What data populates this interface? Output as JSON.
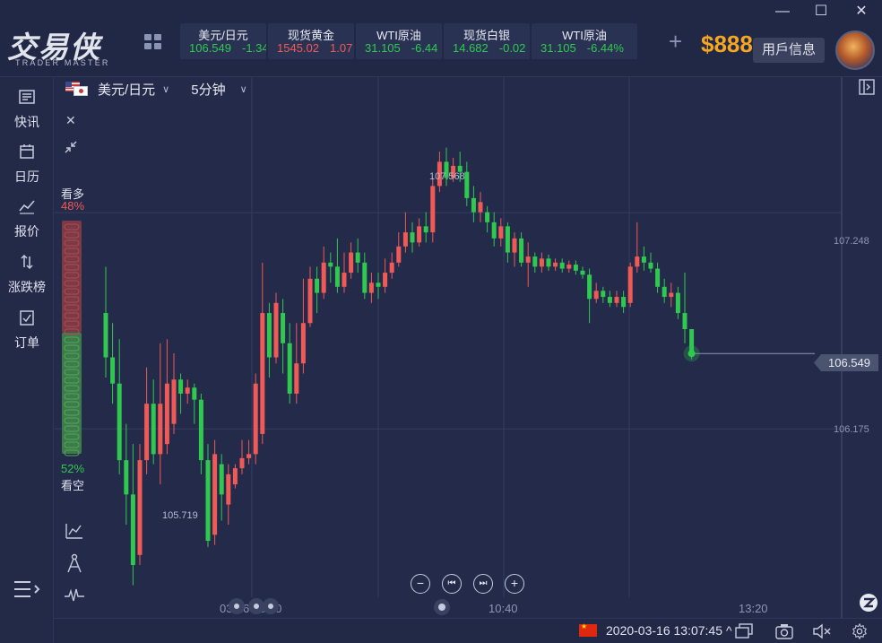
{
  "app": {
    "logo_text": "交易侠",
    "logo_subtitle": "TRADER MASTER",
    "balance": "$888",
    "user_info_label": "用戶信息"
  },
  "window_controls": {
    "minimize": "—",
    "maximize": "☐",
    "close": "✕"
  },
  "tickers": [
    {
      "name": "美元/日元",
      "price": "106.549",
      "change": "-1.34",
      "price_color": "green",
      "change_color": "green"
    },
    {
      "name": "现货黄金",
      "price": "1545.02",
      "change": "1.07",
      "price_color": "red",
      "change_color": "red"
    },
    {
      "name": "WTI原油",
      "price": "31.105",
      "change": "-6.44",
      "price_color": "green",
      "change_color": "green"
    },
    {
      "name": "现货白银",
      "price": "14.682",
      "change": "-0.02",
      "price_color": "green",
      "change_color": "green"
    },
    {
      "name": "WTI原油",
      "price": "31.105",
      "change": "-6.44%",
      "price_color": "green",
      "change_color": "green"
    }
  ],
  "sidebar": {
    "items": [
      {
        "label": "快讯",
        "icon": "news-icon"
      },
      {
        "label": "日历",
        "icon": "calendar-icon"
      },
      {
        "label": "报价",
        "icon": "quote-icon"
      },
      {
        "label": "涨跌榜",
        "icon": "updown-icon"
      },
      {
        "label": "订单",
        "icon": "order-icon"
      }
    ]
  },
  "chart_header": {
    "symbol": "美元/日元",
    "interval": "5分钟"
  },
  "sentiment": {
    "bull_label": "看多",
    "bull_pct": "48%",
    "bear_label": "看空",
    "bear_pct": "52%",
    "bull_fraction": 0.48
  },
  "colors": {
    "up": "#f05a56",
    "down": "#2fc94f",
    "background": "#242b4a",
    "accent": "#f5a623"
  },
  "chart_data": {
    "type": "candlestick",
    "symbol": "美元/日元",
    "interval": "5分钟",
    "y_ticks": [
      "107.248",
      "106.175"
    ],
    "y_tick_values": [
      107.248,
      106.175
    ],
    "ylim": [
      105.34,
      107.92
    ],
    "x_ticks": [
      "03-16 08:00",
      "10:40",
      "13:20"
    ],
    "high_label": "107.568",
    "low_label": "105.719",
    "last_price": "106.549",
    "candles": [
      [
        106.75,
        106.53,
        106.98,
        106.43
      ],
      [
        106.53,
        106.4,
        106.7,
        106.3
      ],
      [
        106.4,
        106.02,
        106.62,
        105.95
      ],
      [
        106.02,
        105.85,
        106.2,
        105.7
      ],
      [
        105.85,
        105.5,
        106.1,
        105.4
      ],
      [
        105.55,
        106.02,
        106.1,
        105.5
      ],
      [
        106.02,
        106.3,
        106.48,
        105.95
      ],
      [
        106.3,
        106.05,
        106.42,
        106.0
      ],
      [
        106.05,
        106.3,
        106.6,
        105.9
      ],
      [
        106.1,
        106.4,
        106.62,
        106.05
      ],
      [
        106.2,
        106.42,
        106.55,
        106.15
      ],
      [
        106.42,
        106.35,
        106.45,
        106.25
      ],
      [
        106.35,
        106.38,
        106.42,
        106.3
      ],
      [
        106.38,
        106.32,
        106.4,
        106.2
      ],
      [
        106.32,
        106.02,
        106.35,
        105.95
      ],
      [
        106.02,
        105.62,
        106.1,
        105.59
      ],
      [
        105.65,
        106.05,
        106.12,
        105.6
      ],
      [
        106.0,
        105.85,
        106.05,
        105.72
      ],
      [
        105.8,
        105.95,
        106.0,
        105.7
      ],
      [
        105.9,
        105.98,
        106.0,
        105.88
      ],
      [
        105.98,
        106.03,
        106.12,
        105.95
      ],
      [
        106.03,
        106.05,
        106.12,
        106.0
      ],
      [
        106.05,
        106.4,
        106.45,
        106.0
      ],
      [
        106.15,
        106.75,
        107.0,
        106.1
      ],
      [
        106.75,
        106.53,
        106.8,
        106.43
      ],
      [
        106.53,
        106.8,
        106.85,
        106.5
      ],
      [
        106.75,
        106.6,
        106.82,
        106.45
      ],
      [
        106.6,
        106.35,
        106.7,
        106.3
      ],
      [
        106.35,
        106.5,
        106.7,
        106.3
      ],
      [
        106.5,
        106.7,
        106.92,
        106.45
      ],
      [
        106.7,
        106.92,
        106.98,
        106.68
      ],
      [
        106.92,
        106.85,
        106.98,
        106.75
      ],
      [
        106.85,
        107.0,
        107.08,
        106.82
      ],
      [
        107.0,
        106.98,
        107.05,
        106.9
      ],
      [
        106.98,
        106.88,
        107.12,
        106.85
      ],
      [
        106.88,
        106.95,
        107.05,
        106.85
      ],
      [
        106.95,
        107.05,
        107.1,
        106.92
      ],
      [
        107.05,
        107.0,
        107.12,
        106.95
      ],
      [
        107.0,
        106.85,
        107.05,
        106.82
      ],
      [
        106.85,
        106.9,
        106.95,
        106.8
      ],
      [
        106.9,
        106.88,
        106.95,
        106.82
      ],
      [
        106.88,
        106.95,
        107.02,
        106.85
      ],
      [
        106.95,
        107.0,
        107.05,
        106.92
      ],
      [
        107.0,
        107.08,
        107.15,
        106.98
      ],
      [
        107.08,
        107.15,
        107.25,
        107.05
      ],
      [
        107.15,
        107.1,
        107.2,
        107.05
      ],
      [
        107.1,
        107.18,
        107.22,
        107.08
      ],
      [
        107.18,
        107.15,
        107.25,
        107.1
      ],
      [
        107.15,
        107.38,
        107.42,
        107.1
      ],
      [
        107.38,
        107.5,
        107.55,
        107.35
      ],
      [
        107.5,
        107.42,
        107.57,
        107.38
      ],
      [
        107.42,
        107.48,
        107.52,
        107.4
      ],
      [
        107.48,
        107.45,
        107.55,
        107.4
      ],
      [
        107.45,
        107.32,
        107.5,
        107.28
      ],
      [
        107.32,
        107.25,
        107.38,
        107.2
      ],
      [
        107.25,
        107.3,
        107.35,
        107.2
      ],
      [
        107.25,
        107.2,
        107.28,
        107.15
      ],
      [
        107.2,
        107.12,
        107.25,
        107.08
      ],
      [
        107.12,
        107.18,
        107.22,
        107.08
      ],
      [
        107.18,
        107.05,
        107.2,
        107.0
      ],
      [
        107.05,
        107.12,
        107.15,
        106.98
      ],
      [
        107.12,
        107.0,
        107.15,
        106.98
      ],
      [
        107.0,
        107.03,
        107.1,
        106.88
      ],
      [
        107.03,
        106.98,
        107.05,
        106.95
      ],
      [
        106.98,
        107.02,
        107.05,
        106.95
      ],
      [
        107.02,
        106.98,
        107.04,
        106.96
      ],
      [
        106.98,
        107.0,
        107.02,
        106.96
      ],
      [
        107.0,
        106.97,
        107.02,
        106.95
      ],
      [
        106.97,
        106.99,
        107.01,
        106.95
      ],
      [
        106.99,
        106.96,
        107.01,
        106.94
      ],
      [
        106.96,
        106.94,
        106.98,
        106.92
      ],
      [
        106.94,
        106.82,
        106.97,
        106.7
      ],
      [
        106.82,
        106.86,
        106.9,
        106.8
      ],
      [
        106.86,
        106.83,
        106.88,
        106.8
      ],
      [
        106.83,
        106.8,
        106.86,
        106.78
      ],
      [
        106.8,
        106.83,
        106.86,
        106.78
      ],
      [
        106.83,
        106.78,
        106.86,
        106.75
      ],
      [
        106.8,
        106.98,
        107.0,
        106.78
      ],
      [
        106.98,
        107.03,
        107.2,
        106.95
      ],
      [
        107.03,
        107.0,
        107.08,
        106.96
      ],
      [
        107.0,
        106.97,
        107.05,
        106.95
      ],
      [
        106.97,
        106.88,
        107.0,
        106.85
      ],
      [
        106.88,
        106.83,
        106.92,
        106.8
      ],
      [
        106.83,
        106.85,
        106.9,
        106.78
      ],
      [
        106.85,
        106.75,
        106.88,
        106.72
      ],
      [
        106.75,
        106.67,
        106.95,
        106.6
      ],
      [
        106.67,
        106.55,
        106.67,
        106.52
      ]
    ]
  },
  "nav_buttons": {
    "zoom_out": "−",
    "prev": "⏮",
    "next": "⏭",
    "zoom_in": "+"
  },
  "status_bar": {
    "datetime": "2020-03-16 13:07:45",
    "caret": "^"
  }
}
